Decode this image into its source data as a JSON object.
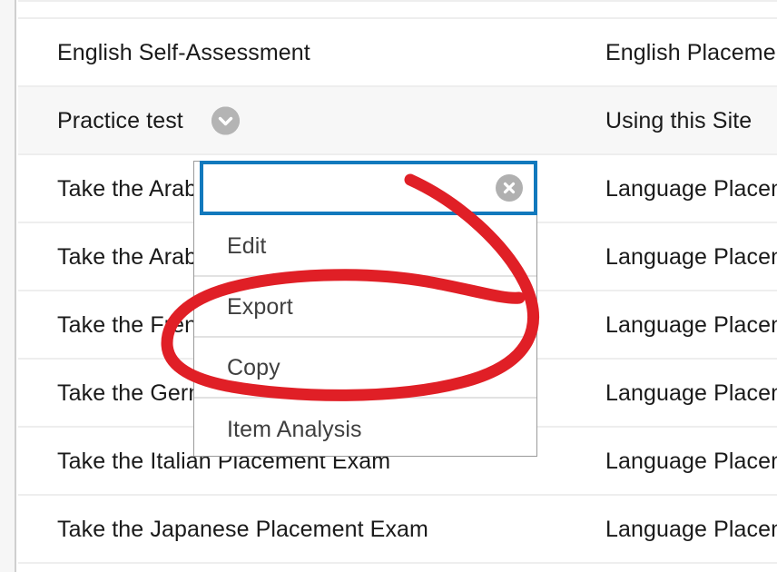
{
  "table": {
    "rows": [
      {
        "title": "",
        "category": "",
        "shaded": false,
        "clipped": true,
        "chevron": false
      },
      {
        "title": "English Self-Assessment",
        "category": "English Placement",
        "shaded": false,
        "clipped": false,
        "chevron": false
      },
      {
        "title": "Practice test",
        "category": "Using this Site",
        "shaded": true,
        "clipped": false,
        "chevron": true
      },
      {
        "title": "Take the Arabic Placement Exam",
        "category": "Language Placement",
        "shaded": false,
        "clipped": false,
        "chevron": false
      },
      {
        "title": "Take the Arabic Placement Exam",
        "category": "Language Placement",
        "shaded": false,
        "clipped": false,
        "chevron": false
      },
      {
        "title": "Take the French Placement Exam",
        "category": "Language Placement",
        "shaded": false,
        "clipped": false,
        "chevron": false
      },
      {
        "title": "Take the German Placement Exam",
        "category": "Language Placement",
        "shaded": false,
        "clipped": false,
        "chevron": false
      },
      {
        "title": "Take the Italian Placement Exam",
        "category": "Language Placement",
        "shaded": false,
        "clipped": false,
        "chevron": false
      },
      {
        "title": "Take the Japanese Placement Exam",
        "category": "Language Placement",
        "shaded": false,
        "clipped": false,
        "chevron": false
      }
    ]
  },
  "dropdown": {
    "search": {
      "value": "",
      "placeholder": "",
      "clear_icon": "clear-circle-icon"
    },
    "items": [
      {
        "label": "Edit"
      },
      {
        "label": "Export"
      },
      {
        "label": "Copy"
      },
      {
        "label": "Item Analysis"
      }
    ]
  },
  "icons": {
    "chevron": "chevron-down-circle-icon"
  },
  "colors": {
    "focus_border": "#1279bd",
    "annotation_red": "#e01f26",
    "row_shade": "#f7f7f7",
    "row_divider": "#eeeeee",
    "menu_text": "#3f3f3f",
    "badge_gray": "#b4b4b4"
  },
  "annotation": {
    "shape": "hand-drawn-red-ellipse",
    "targets": [
      "Export",
      "Copy"
    ]
  }
}
